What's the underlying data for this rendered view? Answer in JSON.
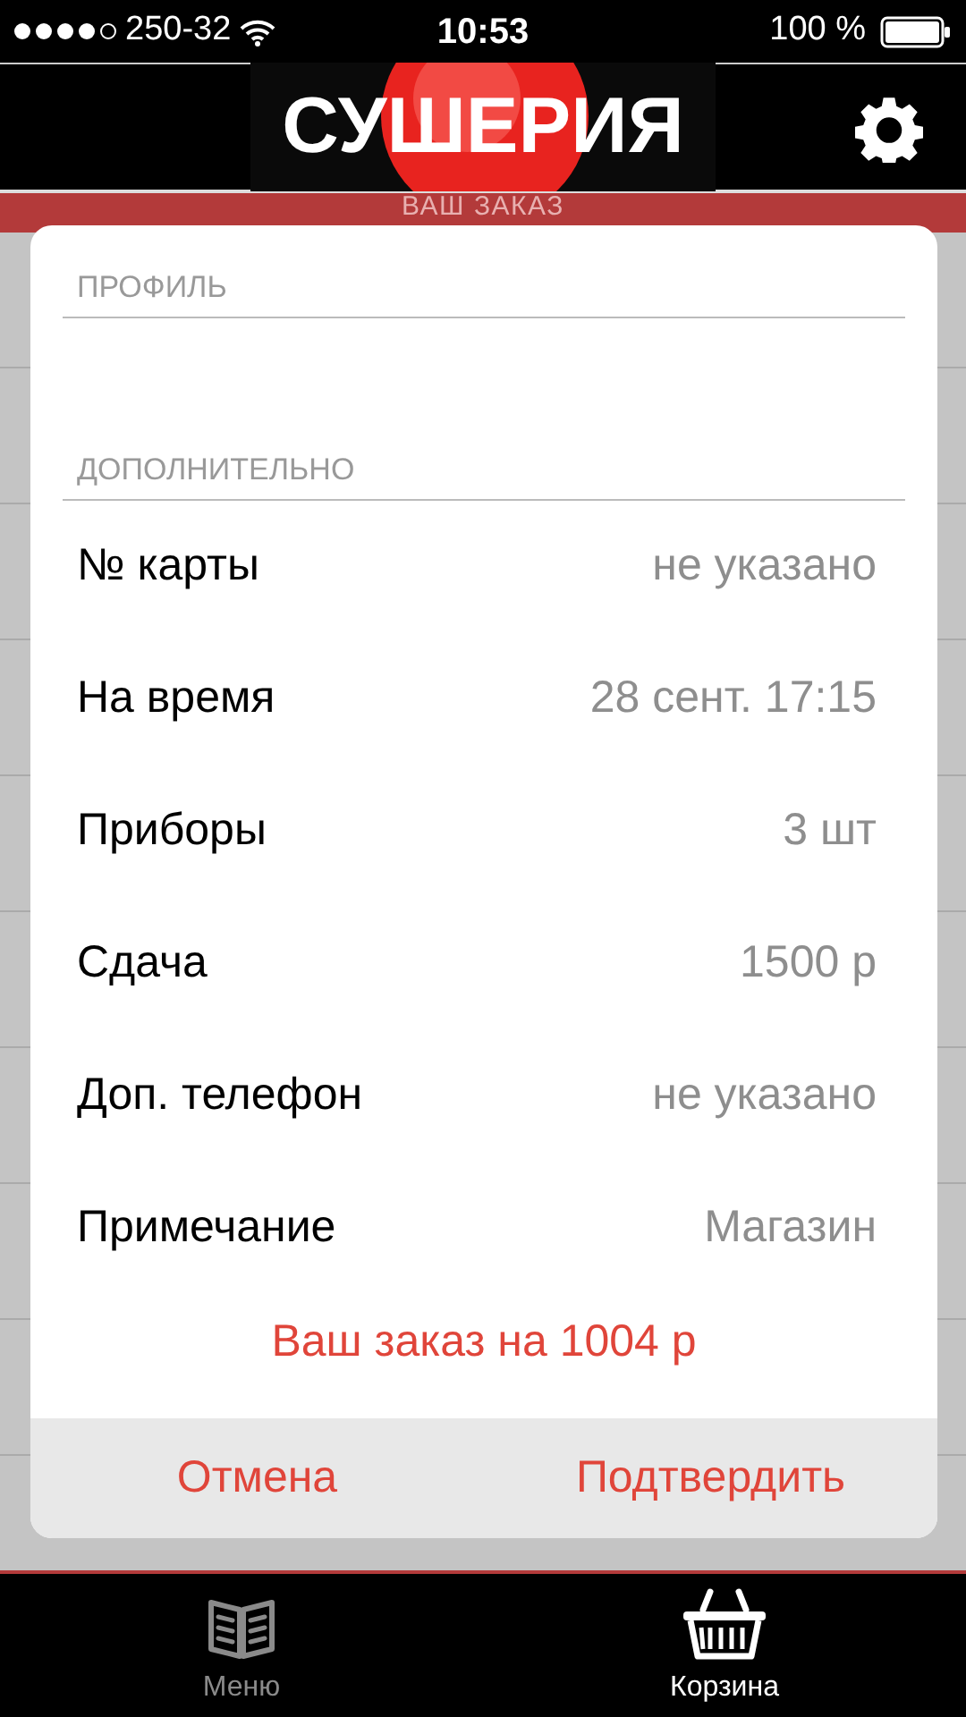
{
  "status_bar": {
    "signal_dots": [
      {
        "filled": true
      },
      {
        "filled": true
      },
      {
        "filled": true
      },
      {
        "filled": true
      },
      {
        "filled": false
      }
    ],
    "carrier": "250-32",
    "time": "10:53",
    "battery": "100 %"
  },
  "header": {
    "logo": "СУШЕРИЯ"
  },
  "order_bar": {
    "title": "ВАШ ЗАКАЗ"
  },
  "dialog": {
    "sections": [
      {
        "title": "ПРОФИЛЬ"
      },
      {
        "title": "ДОПОЛНИТЕЛЬНО",
        "rows": [
          {
            "label": "№ карты",
            "value": "не указано"
          },
          {
            "label": "На время",
            "value": "28 сент. 17:15"
          },
          {
            "label": "Приборы",
            "value": "3 шт"
          },
          {
            "label": "Сдача",
            "value": "1500 р"
          },
          {
            "label": "Доп. телефон",
            "value": "не указано"
          },
          {
            "label": "Примечание",
            "value": "Магазин"
          }
        ]
      }
    ],
    "total": "Ваш заказ на 1004 р",
    "buttons": [
      "Отмена",
      "Подтвердить"
    ]
  },
  "tabs": [
    {
      "label": "Меню",
      "selected": false,
      "kind": "book"
    },
    {
      "label": "Корзина",
      "selected": true,
      "kind": "basket"
    }
  ]
}
